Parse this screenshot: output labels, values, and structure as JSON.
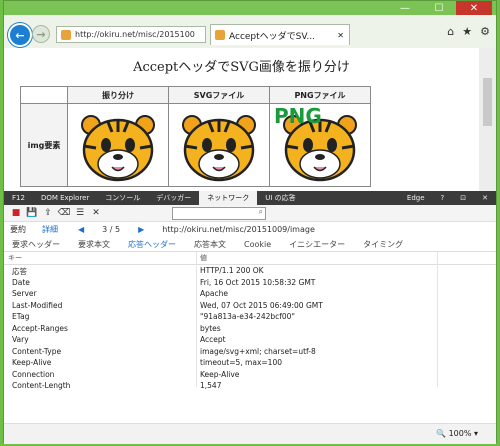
{
  "window": {
    "min": "—",
    "max": "☐",
    "close": "✕"
  },
  "nav": {
    "address": "http://okiru.net/misc/2015100",
    "tab_title": "AcceptヘッダでSV...",
    "tab_close": "✕"
  },
  "page": {
    "title": "AcceptヘッダでSVG画像を振り分け",
    "columns": [
      "振り分け",
      "SVGファイル",
      "PNGファイル"
    ],
    "row_label": "img要素",
    "png_overlay": "PNG"
  },
  "devtools": {
    "tabs": [
      "F12",
      "DOM Explorer",
      "コンソール",
      "デバッガー",
      "ネットワーク",
      "UI の応答"
    ],
    "selected_tab": "ネットワーク",
    "right_buttons": [
      "Edge",
      "?",
      "⊡",
      "✕"
    ],
    "summary_label": "要約",
    "detail_label": "詳細",
    "pager": "3 / 5",
    "url": "http://okiru.net/misc/20151009/image",
    "subtabs": [
      "要求ヘッダー",
      "要求本文",
      "応答ヘッダー",
      "応答本文",
      "Cookie",
      "イニシエーター",
      "タイミング"
    ],
    "selected_subtab": "応答ヘッダー",
    "col_key": "キー",
    "col_value": "値",
    "headers": [
      {
        "k": "応答",
        "v": "HTTP/1.1 200 OK"
      },
      {
        "k": "Date",
        "v": "Fri, 16 Oct 2015 10:58:32 GMT"
      },
      {
        "k": "Server",
        "v": "Apache"
      },
      {
        "k": "Last-Modified",
        "v": "Wed, 07 Oct 2015 06:49:00 GMT"
      },
      {
        "k": "ETag",
        "v": "\"91a813a-e34-242bcf00\""
      },
      {
        "k": "Accept-Ranges",
        "v": "bytes"
      },
      {
        "k": "Vary",
        "v": "Accept"
      },
      {
        "k": "Content-Type",
        "v": "image/svg+xml; charset=utf-8"
      },
      {
        "k": "Keep-Alive",
        "v": "timeout=5, max=100"
      },
      {
        "k": "Connection",
        "v": "Keep-Alive"
      },
      {
        "k": "Content-Length",
        "v": "1,547"
      }
    ],
    "zoom": "100%"
  }
}
